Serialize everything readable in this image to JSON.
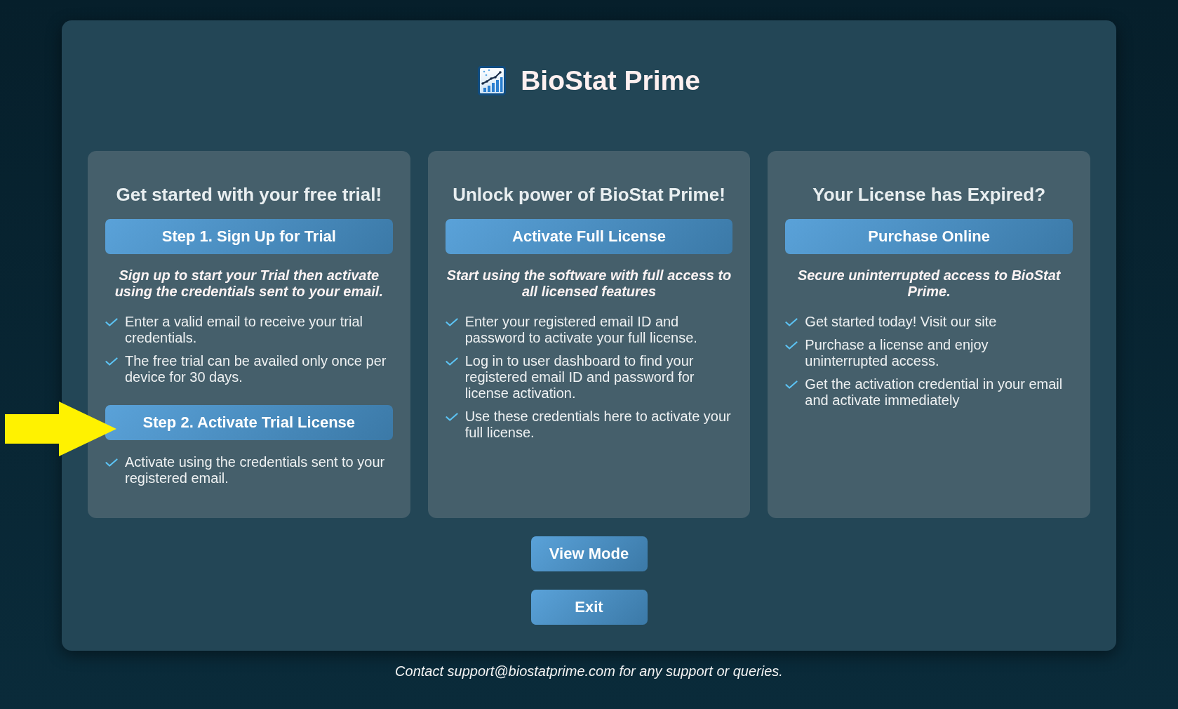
{
  "header": {
    "title": "BioStat Prime"
  },
  "cards": [
    {
      "heading": "Get started with your free trial!",
      "blocks": [
        {
          "kind": "button",
          "label": "Step 1. Sign Up for Trial"
        },
        {
          "kind": "note",
          "text": "Sign up to start your Trial then activate using the credentials sent to your email."
        },
        {
          "kind": "checklist",
          "items": [
            "Enter a valid email to receive your trial credentials.",
            "The free trial can be availed only once per device for 30 days."
          ]
        },
        {
          "kind": "button",
          "label": "Step 2. Activate Trial License"
        },
        {
          "kind": "checklist",
          "items": [
            "Activate using the credentials sent to your registered email."
          ]
        }
      ]
    },
    {
      "heading": "Unlock power of BioStat Prime!",
      "blocks": [
        {
          "kind": "button",
          "label": "Activate Full License"
        },
        {
          "kind": "note",
          "text": "Start using the software with full access to all licensed features"
        },
        {
          "kind": "checklist",
          "items": [
            "Enter your registered email ID and password to activate your full license.",
            "Log in to user dashboard to find your registered email ID and password for license activation.",
            "Use these credentials here to activate your full license."
          ]
        }
      ]
    },
    {
      "heading": "Your License has Expired?",
      "blocks": [
        {
          "kind": "button",
          "label": "Purchase Online"
        },
        {
          "kind": "note",
          "text": "Secure uninterrupted access to BioStat Prime."
        },
        {
          "kind": "checklist",
          "items": [
            "Get started today! Visit our site",
            "Purchase a license and enjoy uninterrupted access.",
            "Get the activation credential in your email and activate immediately"
          ]
        }
      ]
    }
  ],
  "actions": [
    {
      "label": "View Mode"
    },
    {
      "label": "Exit"
    }
  ],
  "footer": {
    "text": "Contact support@biostatprime.com for any support or queries."
  }
}
